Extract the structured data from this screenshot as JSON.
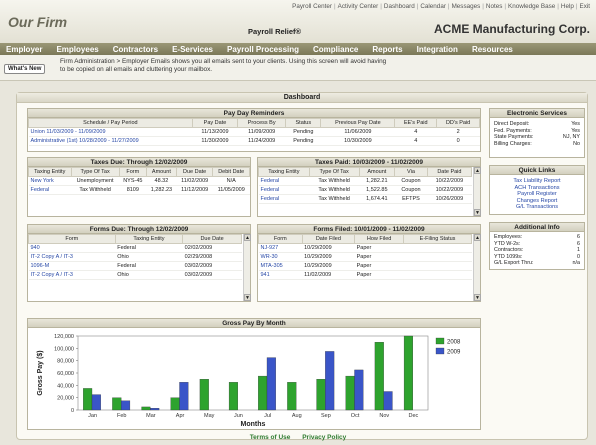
{
  "header": {
    "logo": "Our Firm",
    "product": "Payroll Relief®",
    "company": "ACME Manufacturing Corp.",
    "top_links": [
      "Payroll Center",
      "Activity Center",
      "Dashboard",
      "Calendar",
      "Messages",
      "Notes",
      "Knowledge Base",
      "Help",
      "Exit"
    ]
  },
  "nav": [
    "Employer",
    "Employees",
    "Contractors",
    "E-Services",
    "Payroll Processing",
    "Compliance",
    "Reports",
    "Integration",
    "Resources"
  ],
  "subbar": {
    "whats_new": "What's New",
    "text": "Firm Administration > Employer Emails shows you all emails sent to your clients. Using this screen will avoid having to be copied on all emails and cluttering your mailbox."
  },
  "dashboard": {
    "title": "Dashboard",
    "reminders": {
      "title": "Pay Day Reminders",
      "headers": [
        "Schedule / Pay Period",
        "Pay Date",
        "Process By",
        "Status",
        "Previous Pay Date",
        "EE's Paid",
        "DD's Paid"
      ],
      "rows": [
        [
          "Union 11/03/2009 - 11/09/2009",
          "11/13/2009",
          "11/09/2009",
          "Pending",
          "11/06/2009",
          "4",
          "2"
        ],
        [
          "Administrative (1st) 10/28/2009 - 11/27/2009",
          "11/30/2009",
          "11/24/2009",
          "Pending",
          "10/30/2009",
          "4",
          "0"
        ]
      ]
    },
    "taxes_due": {
      "title": "Taxes Due: Through 12/02/2009",
      "headers": [
        "Taxing Entity",
        "Type Of Tax",
        "Form",
        "Amount",
        "Due Date",
        "Debit Date"
      ],
      "rows": [
        [
          "New York",
          "Unemployment",
          "NYS-45",
          "48.32",
          "11/02/2009",
          "N/A"
        ],
        [
          "Federal",
          "Tax Withheld",
          "8109",
          "1,282.23",
          "11/12/2009",
          "11/05/2009"
        ]
      ]
    },
    "taxes_paid": {
      "title": "Taxes Paid: 10/03/2009 - 11/02/2009",
      "headers": [
        "Taxing Entity",
        "Type Of Tax",
        "Amount",
        "Via",
        "Date Paid"
      ],
      "rows": [
        [
          "Federal",
          "Tax Withheld",
          "1,282.21",
          "Coupon",
          "10/22/2009"
        ],
        [
          "Federal",
          "Tax Withheld",
          "1,522.85",
          "Coupon",
          "10/22/2009"
        ],
        [
          "Federal",
          "Tax Withheld",
          "1,674.41",
          "EFTPS",
          "10/26/2009"
        ]
      ]
    },
    "forms_due": {
      "title": "Forms Due: Through 12/02/2009",
      "headers": [
        "Form",
        "Taxing Entity",
        "Due Date"
      ],
      "rows": [
        [
          "940",
          "Federal",
          "02/02/2009"
        ],
        [
          "IT-2 Copy A / IT-3",
          "Ohio",
          "02/29/2008"
        ],
        [
          "1096-M",
          "Federal",
          "03/02/2009"
        ],
        [
          "IT-2 Copy A / IT-3",
          "Ohio",
          "03/02/2009"
        ]
      ]
    },
    "forms_filed": {
      "title": "Forms Filed: 10/01/2009 - 11/02/2009",
      "headers": [
        "Form",
        "Date Filed",
        "How Filed",
        "E-Filing Status"
      ],
      "rows": [
        [
          "NJ-927",
          "10/29/2009",
          "Paper",
          ""
        ],
        [
          "WR-30",
          "10/29/2009",
          "Paper",
          ""
        ],
        [
          "MTA-305",
          "10/29/2009",
          "Paper",
          ""
        ],
        [
          "941",
          "11/02/2009",
          "Paper",
          ""
        ]
      ]
    }
  },
  "right": {
    "eservices": {
      "title": "Electronic Services",
      "items": [
        [
          "Direct Deposit:",
          "Yes"
        ],
        [
          "Fed. Payments:",
          "Yes"
        ],
        [
          "State Payments:",
          "NJ, NY"
        ],
        [
          "Billing Charges:",
          "No"
        ]
      ]
    },
    "quick_links": {
      "title": "Quick Links",
      "items": [
        "Tax Liability Report",
        "ACH Transactions",
        "Payroll Register",
        "Changes Report",
        "G/L Transactions"
      ]
    },
    "additional": {
      "title": "Additional Info",
      "items": [
        [
          "Employees:",
          "6"
        ],
        [
          "YTD W-2s:",
          "6"
        ],
        [
          "Contractors:",
          "1"
        ],
        [
          "YTD 1099s:",
          "0"
        ],
        [
          "G/L Export Thru:",
          "n/a"
        ]
      ]
    }
  },
  "chart_data": {
    "type": "bar",
    "title": "Gross Pay By Month",
    "xlabel": "Months",
    "ylabel": "Gross Pay ($)",
    "categories": [
      "Jan",
      "Feb",
      "Mar",
      "Apr",
      "May",
      "Jun",
      "Jul",
      "Aug",
      "Sep",
      "Oct",
      "Nov",
      "Dec"
    ],
    "ylim": [
      0,
      120000
    ],
    "yticks": [
      "0",
      "20,000",
      "40,000",
      "60,000",
      "80,000",
      "100,000",
      "120,000"
    ],
    "series": [
      {
        "name": "2008",
        "color": "#2ea32e",
        "values": [
          35000,
          20000,
          5000,
          20000,
          50000,
          45000,
          55000,
          45000,
          50000,
          55000,
          110000,
          120000
        ]
      },
      {
        "name": "2009",
        "color": "#3a55c8",
        "values": [
          25000,
          15000,
          3000,
          45000,
          0,
          0,
          85000,
          0,
          95000,
          65000,
          30000,
          0
        ]
      }
    ],
    "legend": "right"
  },
  "footer": {
    "links": [
      "Terms of Use",
      "Privacy Policy"
    ]
  }
}
